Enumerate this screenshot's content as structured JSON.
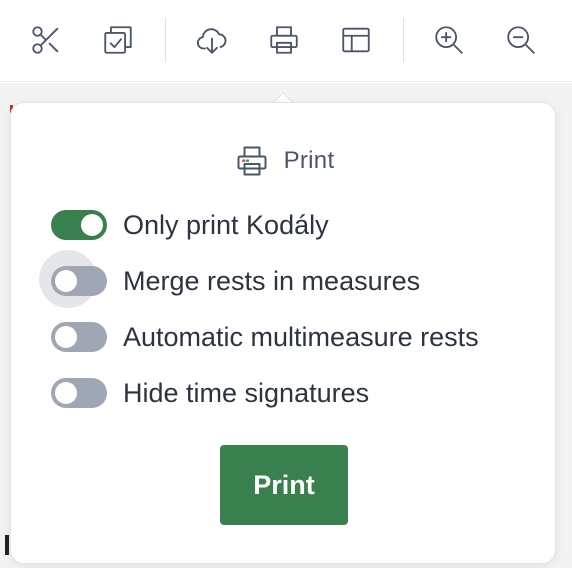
{
  "toolbar": {
    "buttons": [
      {
        "name": "cut",
        "icon": "scissors-icon"
      },
      {
        "name": "copy",
        "icon": "copy-check-icon"
      },
      {
        "name": "download",
        "icon": "cloud-download-icon"
      },
      {
        "name": "print",
        "icon": "printer-icon"
      },
      {
        "name": "layout",
        "icon": "layout-icon"
      },
      {
        "name": "zoom-in",
        "icon": "zoom-in-icon"
      },
      {
        "name": "zoom-out",
        "icon": "zoom-out-icon"
      }
    ]
  },
  "print_panel": {
    "title": "Print",
    "options": [
      {
        "label": "Only print Kodály",
        "checked": true
      },
      {
        "label": "Merge rests in measures",
        "checked": false
      },
      {
        "label": "Automatic multimeasure rests",
        "checked": false
      },
      {
        "label": "Hide time signatures",
        "checked": false
      }
    ],
    "print_label": "Print"
  },
  "colors": {
    "accent_green": "#3a7f4e",
    "toggle_off": "#a0a7b4",
    "icon_gray": "#4a5568",
    "text_dark": "#2d3441"
  }
}
